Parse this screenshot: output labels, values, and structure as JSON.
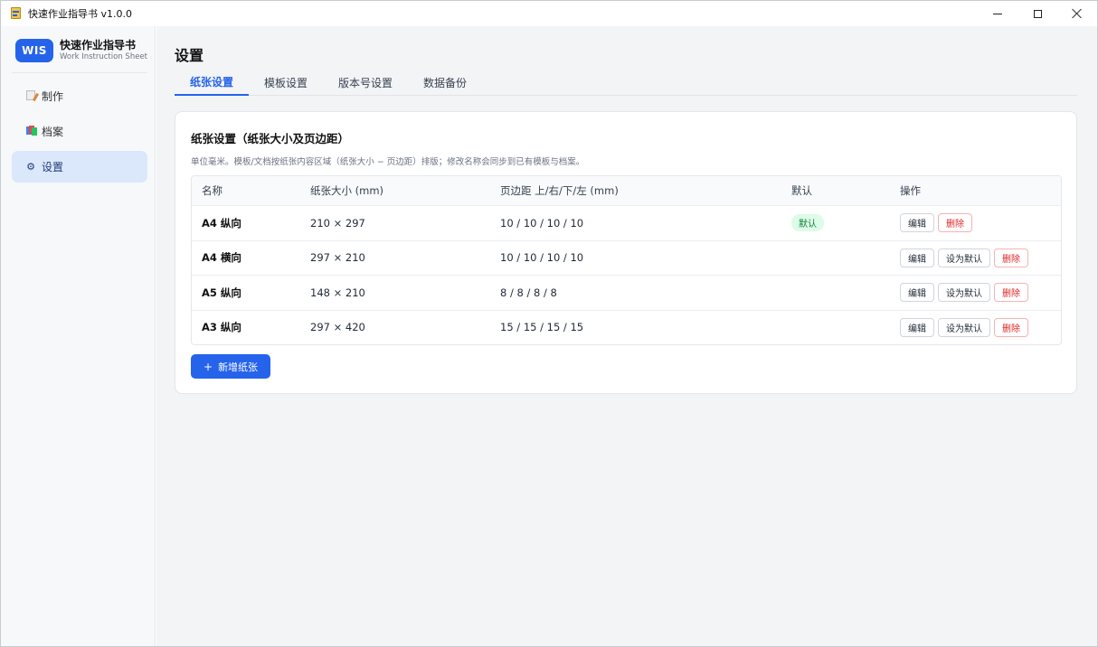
{
  "window": {
    "title": "快速作业指导书 v1.0.0"
  },
  "brand": {
    "logo": "WIS",
    "name": "快速作业指导书",
    "subtitle": "Work Instruction Sheet"
  },
  "sidebar": {
    "items": [
      {
        "label": "制作",
        "icon": "edit-doc-icon",
        "active": false
      },
      {
        "label": "档案",
        "icon": "files-icon",
        "active": false
      },
      {
        "label": "设置",
        "icon": "gear-icon",
        "glyph": "⚙",
        "active": true
      }
    ]
  },
  "page": {
    "title": "设置"
  },
  "tabs": [
    {
      "label": "纸张设置",
      "active": true
    },
    {
      "label": "模板设置",
      "active": false
    },
    {
      "label": "版本号设置",
      "active": false
    },
    {
      "label": "数据备份",
      "active": false
    }
  ],
  "card": {
    "title": "纸张设置（纸张大小及页边距）",
    "description": "单位毫米。模板/文档按纸张内容区域（纸张大小 − 页边距）排版；修改名称会同步到已有模板与档案。"
  },
  "table": {
    "headers": {
      "name": "名称",
      "size": "纸张大小 (mm)",
      "margin": "页边距 上/右/下/左 (mm)",
      "default": "默认",
      "actions": "操作"
    },
    "rows": [
      {
        "name": "A4 纵向",
        "size": "210 × 297",
        "margin": "10 / 10 / 10 / 10",
        "is_default": true,
        "default_badge": "默认"
      },
      {
        "name": "A4 横向",
        "size": "297 × 210",
        "margin": "10 / 10 / 10 / 10",
        "is_default": false
      },
      {
        "name": "A5 纵向",
        "size": "148 × 210",
        "margin": "8 / 8 / 8 / 8",
        "is_default": false
      },
      {
        "name": "A3 纵向",
        "size": "297 × 420",
        "margin": "15 / 15 / 15 / 15",
        "is_default": false
      }
    ],
    "actions": {
      "edit": "编辑",
      "set_default": "设为默认",
      "delete": "删除"
    }
  },
  "add_button": {
    "plus": "+",
    "label": "新增纸张"
  },
  "colors": {
    "accent": "#2563eb",
    "danger": "#dc2626",
    "success_bg": "#dcfce7",
    "success_text": "#15803d"
  }
}
